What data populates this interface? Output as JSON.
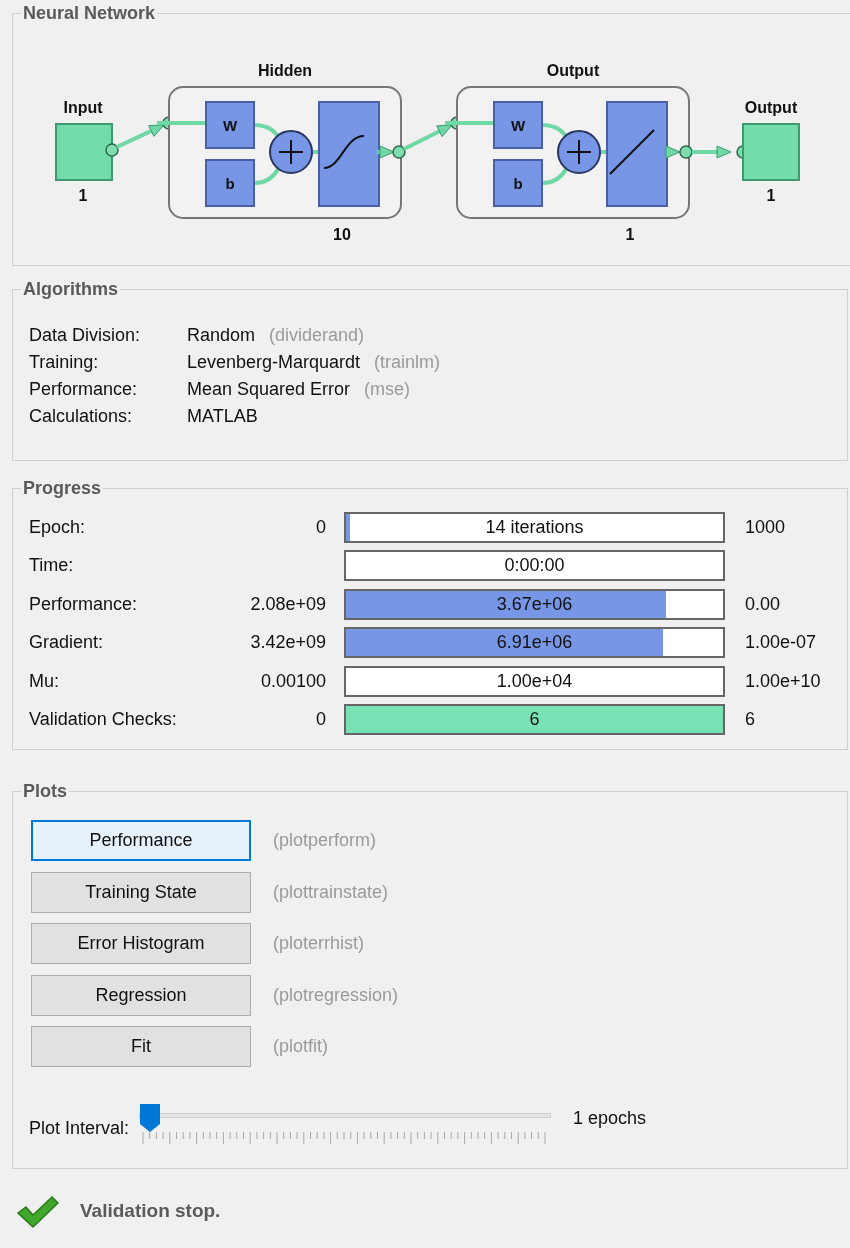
{
  "network": {
    "title": "Neural Network",
    "input": {
      "label": "Input",
      "size": "1"
    },
    "layers": [
      {
        "title": "Hidden",
        "weight": "W",
        "bias": "b",
        "kind": "sigmoid",
        "size": "10"
      },
      {
        "title": "Output",
        "weight": "W",
        "bias": "b",
        "kind": "linear",
        "size": "1"
      }
    ],
    "output": {
      "label": "Output",
      "size": "1"
    }
  },
  "algorithms": {
    "title": "Algorithms",
    "rows": [
      {
        "label": "Data Division:",
        "value": "Random",
        "hint": "(dividerand)"
      },
      {
        "label": "Training:",
        "value": "Levenberg-Marquardt",
        "hint": "(trainlm)"
      },
      {
        "label": "Performance:",
        "value": "Mean Squared Error",
        "hint": "(mse)"
      },
      {
        "label": "Calculations:",
        "value": "MATLAB"
      }
    ]
  },
  "progress": {
    "title": "Progress",
    "rows": [
      {
        "label": "Epoch:",
        "start": "0",
        "reading": "14 iterations",
        "end": "1000",
        "level": 0.01,
        "color": "#7896e6"
      },
      {
        "label": "Time:",
        "reading": "0:00:00"
      },
      {
        "label": "Performance:",
        "start": "2.08e+09",
        "reading": "3.67e+06",
        "end": "0.00",
        "level": 0.85,
        "color": "#7896e6"
      },
      {
        "label": "Gradient:",
        "start": "3.42e+09",
        "reading": "6.91e+06",
        "end": "1.00e-07",
        "level": 0.84,
        "color": "#7896e6"
      },
      {
        "label": "Mu:",
        "start": "0.00100",
        "reading": "1.00e+04",
        "end": "1.00e+10"
      },
      {
        "label": "Validation Checks:",
        "start": "0",
        "reading": "6",
        "end": "6",
        "level": 1,
        "color": "#78e2b4"
      }
    ]
  },
  "plots": {
    "title": "Plots",
    "buttons": [
      {
        "label": "Performance",
        "hint": "(plotperform)",
        "selected": true
      },
      {
        "label": "Training State",
        "hint": "(plottrainstate)",
        "selected": false
      },
      {
        "label": "Error Histogram",
        "hint": "(ploterrhist)",
        "selected": false
      },
      {
        "label": "Regression",
        "hint": "(plotregression)",
        "selected": false
      },
      {
        "label": "Fit",
        "hint": "(plotfit)",
        "selected": false
      }
    ],
    "interval": {
      "label": "Plot Interval:",
      "level": 0,
      "reading": "1 epochs"
    }
  },
  "status": {
    "text": "Validation stop."
  }
}
